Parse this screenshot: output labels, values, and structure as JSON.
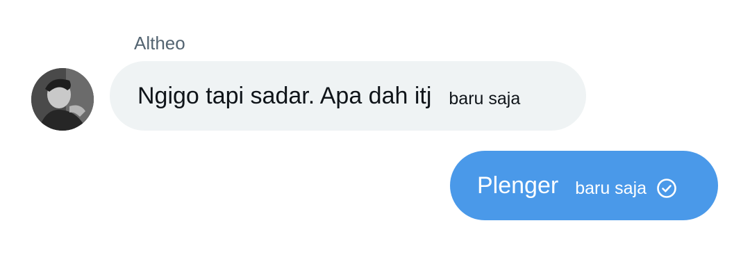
{
  "conversation": {
    "incoming": {
      "sender_name": "Altheo",
      "text": "Ngigo tapi sadar. Apa dah itj",
      "time": "baru saja"
    },
    "outgoing": {
      "text": "Plenger",
      "time": "baru saja",
      "status_icon": "check-circle-icon"
    }
  },
  "colors": {
    "incoming_bubble": "#eff3f4",
    "outgoing_bubble": "#4a99e9",
    "sender_name": "#536471",
    "text_dark": "#0f1419"
  }
}
